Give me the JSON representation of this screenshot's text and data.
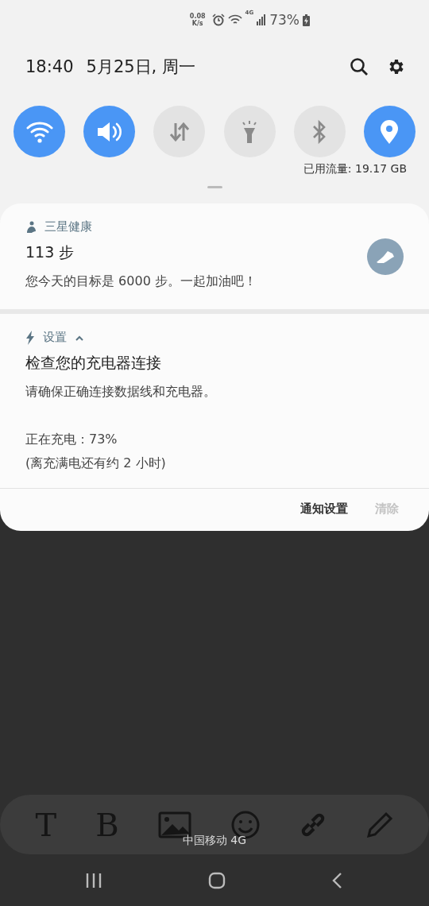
{
  "status_bar": {
    "speed_value": "0.08",
    "speed_unit": "K/s",
    "network": "4G",
    "battery": "73%"
  },
  "header": {
    "time": "18:40",
    "date": "5月25日, 周一"
  },
  "quick_toggles": [
    {
      "kind": "wifi",
      "on": true
    },
    {
      "kind": "sound",
      "on": true
    },
    {
      "kind": "data",
      "on": false
    },
    {
      "kind": "flashlight",
      "on": false
    },
    {
      "kind": "bluetooth",
      "on": false
    },
    {
      "kind": "location",
      "on": true
    }
  ],
  "data_usage": "已用流量: 19.17 GB",
  "notifications": [
    {
      "kind": "health",
      "app": "三星健康",
      "title": "113 步",
      "paragraphs": [
        [
          "您今天的目标是 6000 步。一起加油吧！"
        ]
      ]
    },
    {
      "kind": "charging",
      "app": "设置",
      "expanded": true,
      "title": "检查您的充电器连接",
      "paragraphs": [
        [
          "请确保正确连接数据线和充电器。"
        ],
        [
          "正在充电：73%",
          "(离充满电还有约 2 小时)"
        ]
      ]
    }
  ],
  "notification_actions": [
    {
      "label": "通知设置",
      "disabled": false
    },
    {
      "label": "清除",
      "disabled": true
    }
  ],
  "background_toolbar": [
    {
      "kind": "text",
      "label": "T"
    },
    {
      "kind": "text",
      "label": "B"
    },
    {
      "kind": "image"
    },
    {
      "kind": "emoji"
    },
    {
      "kind": "link"
    },
    {
      "kind": "pencil"
    }
  ],
  "carrier": "中国移动 4G"
}
